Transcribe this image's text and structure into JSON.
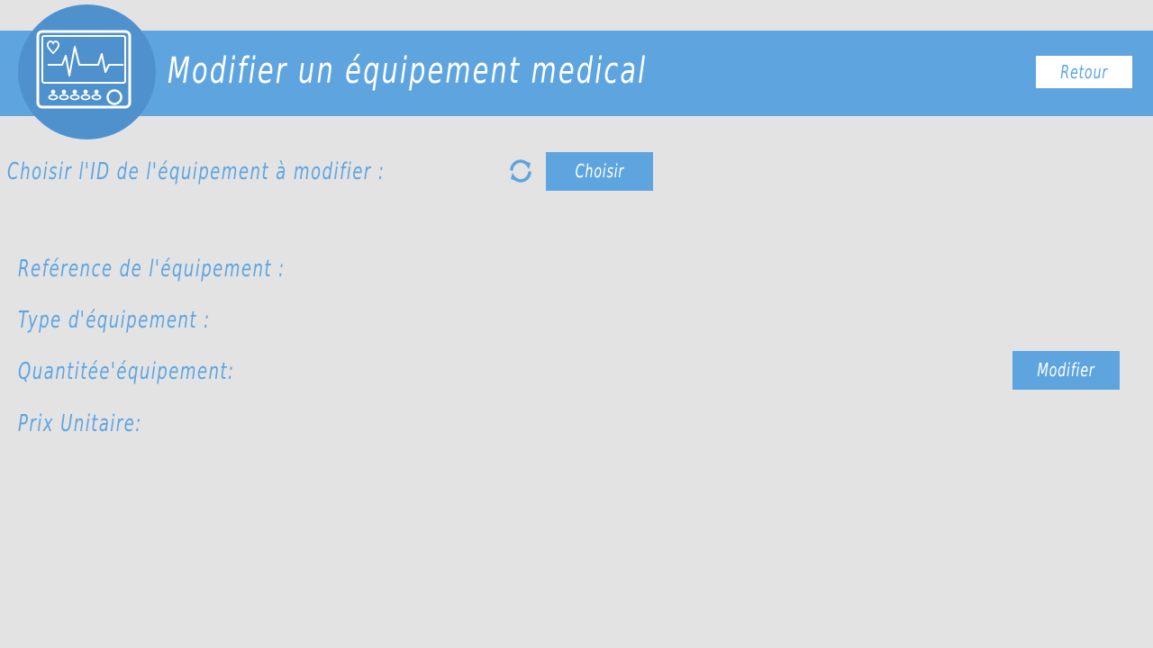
{
  "header": {
    "title": "Modifier un équipement medical",
    "back_label": "Retour",
    "logo_icon": "medical-monitor-icon"
  },
  "selector": {
    "label": "Choisir l'ID de l'équipement à modifier :",
    "refresh_icon": "refresh-icon",
    "choose_label": "Choisir"
  },
  "form": {
    "reference_label": "Reférence de l'équipement :",
    "type_label": "Type d'équipement :",
    "quantity_label": "Quantitée'équipement:",
    "price_label": "Prix Unitaire:",
    "modify_label": "Modifier"
  },
  "colors": {
    "accent": "#5ea5e0",
    "logo_background": "#4f91cc",
    "page_background": "#e3e3e4"
  }
}
